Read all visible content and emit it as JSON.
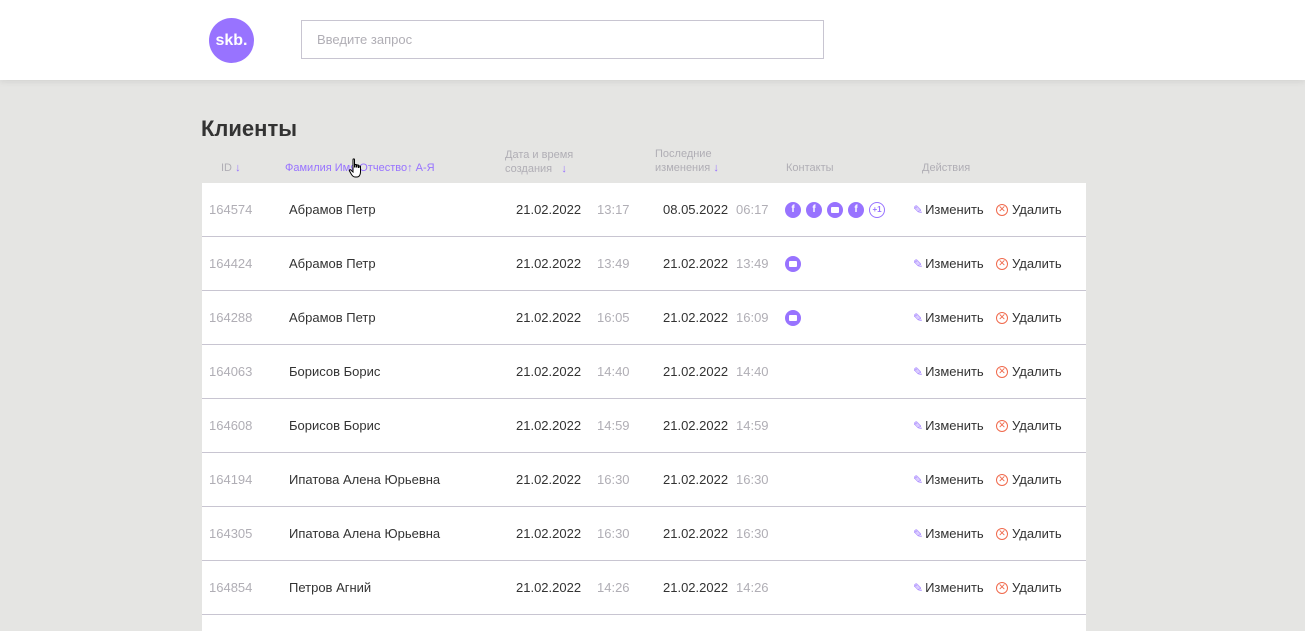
{
  "header": {
    "logo_text": "skb.",
    "search_placeholder": "Введите запрос"
  },
  "page": {
    "title": "Клиенты"
  },
  "columns": {
    "id": "ID",
    "fio": "Фамилия Имя Отчество",
    "fio_sort": "↑ А-Я",
    "created_line1": "Дата и время",
    "created_line2": "создания",
    "updated_line1": "Последние",
    "updated_line2": "изменения",
    "contacts": "Контакты",
    "actions": "Действия",
    "sort_arrow": "↓"
  },
  "actions": {
    "edit": "Изменить",
    "delete": "Удалить"
  },
  "icons": {
    "facebook": "facebook-icon",
    "mail": "mail-icon",
    "more": "+1"
  },
  "colors": {
    "accent": "#9873ff",
    "danger": "#f06a4d",
    "muted": "#b0aeb5",
    "background": "#e5e5e3"
  },
  "rows": [
    {
      "id": "164574",
      "name": "Абрамов Петр",
      "created_date": "21.02.2022",
      "created_time": "13:17",
      "updated_date": "08.05.2022",
      "updated_time": "06:17",
      "contacts": [
        "facebook",
        "facebook",
        "mail",
        "facebook",
        "more"
      ]
    },
    {
      "id": "164424",
      "name": "Абрамов Петр",
      "created_date": "21.02.2022",
      "created_time": "13:49",
      "updated_date": "21.02.2022",
      "updated_time": "13:49",
      "contacts": [
        "mail"
      ]
    },
    {
      "id": "164288",
      "name": "Абрамов Петр",
      "created_date": "21.02.2022",
      "created_time": "16:05",
      "updated_date": "21.02.2022",
      "updated_time": "16:09",
      "contacts": [
        "mail"
      ]
    },
    {
      "id": "164063",
      "name": "Борисов Борис",
      "created_date": "21.02.2022",
      "created_time": "14:40",
      "updated_date": "21.02.2022",
      "updated_time": "14:40",
      "contacts": []
    },
    {
      "id": "164608",
      "name": "Борисов Борис",
      "created_date": "21.02.2022",
      "created_time": "14:59",
      "updated_date": "21.02.2022",
      "updated_time": "14:59",
      "contacts": []
    },
    {
      "id": "164194",
      "name": "Ипатова Алена Юрьевна",
      "created_date": "21.02.2022",
      "created_time": "16:30",
      "updated_date": "21.02.2022",
      "updated_time": "16:30",
      "contacts": []
    },
    {
      "id": "164305",
      "name": "Ипатова Алена Юрьевна",
      "created_date": "21.02.2022",
      "created_time": "16:30",
      "updated_date": "21.02.2022",
      "updated_time": "16:30",
      "contacts": []
    },
    {
      "id": "164854",
      "name": "Петров Агний",
      "created_date": "21.02.2022",
      "created_time": "14:26",
      "updated_date": "21.02.2022",
      "updated_time": "14:26",
      "contacts": []
    }
  ]
}
